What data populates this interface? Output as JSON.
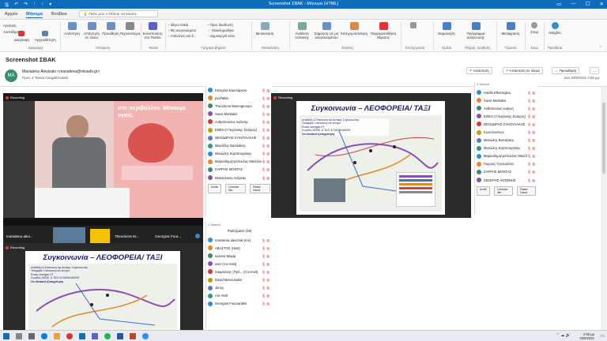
{
  "window": {
    "title": "Screenshot ΣΒΑΚ  -  Μήνυμα (HTML)"
  },
  "tabs": [
    {
      "label": "Αρχείο"
    },
    {
      "label": "Μήνυμα"
    },
    {
      "label": "Βοήθεια"
    }
  ],
  "search": {
    "placeholder": "Πείτε μου τι θέλετε να κάνετε"
  },
  "ribbon": {
    "delete": {
      "ignore": "Αγνόηση",
      "junk": "Ανεπιθύμητα",
      "delete": "Διαγραφή",
      "archive": "Αρχειοθέτηση",
      "group": "Διαγραφή"
    },
    "respond": {
      "reply": "Απάντηση",
      "reply_all": "Απάντηση σε όλους",
      "forward": "Προώθηση",
      "more": "Περισσότερα",
      "group": "Απόκριση"
    },
    "teams": {
      "share": "Κοινοποίηση στο Teams",
      "group": "Teams"
    },
    "quick_steps": {
      "items": [
        "Ιδέρα Αλικιά",
        "Μη αναγνωσμένο",
        "Απάντηση και δ...",
        "Προς διευθυντή",
        "Ολοκληρώθηκε",
        "Δημιουργία νέου"
      ],
      "group": "Γρήγορα βήματα"
    },
    "move": {
      "move": "Μετακίνηση",
      "group": "Μετακίνηση"
    },
    "tags": {
      "assign": "Ανάθεση πολιτικής",
      "mark_unread": "Σήμανση ως μη αναγνωσμένου",
      "categorize": "Κατηγοριοποίηση",
      "follow_up": "Παρακολούθηση θέματος",
      "group": "Ετικέτες"
    },
    "editing": {
      "group": "Επεξεργασία"
    },
    "speech": {
      "read": "Εκφώνηση",
      "group": "Ομιλία"
    },
    "immersive": {
      "reader": "Πρόγραμμα ανάγνωσης",
      "group": "Πλήρης προβολή"
    },
    "translate": {
      "label": "Μετάφραση",
      "group": "Γλώσσα"
    },
    "zoom": {
      "label": "Ζουμ",
      "group": "Ζουμ"
    },
    "insights": {
      "label": "Insights",
      "group": "Πρόσθετα"
    }
  },
  "message": {
    "subject": "Screenshot ΣΒΑΚ",
    "avatar_initials": "MA",
    "from": "Marialena Alevizaki <marialena@mlsadv.gr>",
    "to_label": "Προς",
    "to": "Tessa Gargathoulaki",
    "buttons": {
      "reply": "Απάντηση",
      "reply_all": "Απάντηση σε όλους",
      "forward": "Προώθηση"
    },
    "date": "Δευ 20/9/2021 2:58 μμ"
  },
  "meeting": {
    "recording_label": "Recording",
    "tiles": [
      "marialena alev...",
      "Theodoros M...",
      "Georgios Four..."
    ],
    "slide_title": "Συγκοινωνία – ΛΕΟΦΟΡΕΙΑ/ ΤΑΞΙ",
    "slide_bullets": [
      "Ανάδειξη & Επέκταση της Αστικής Συγκοινωνίας",
      "Τελεφερίκ / επέκταση στο κέντρο",
      "Ενιαίο εισιτήριο ΚΤ",
      "Λωρίδες ΛΕΩΦ. & ΤΑΞΙ & ΠΑΡΑΚΑΜΨΗ",
      "On demand εξυπηρέτηση"
    ],
    "banner_text": "στο περιβάλλον. Μένουμε υγιείς.",
    "participants_header": "Participants (28)",
    "list_a": [
      "Κατερίνα Κλεισιάρκου",
      "pvaTabla",
      "Theodoros Mavrogenopo",
      "Xanis Markakis",
      "Ανθρόπουλος Ιωάννης",
      "ΕΘΕΗ (Υπεράνκης Σταύρος)",
      "ΘΕΟΔΩΡΗΣ ΣΥΚΟΥΛΑΚΗΣ",
      "Μαυλίδης Βασιλάκης",
      "Μανώλης Καρτσουράκης",
      "Μαρκοδημητρόπουλος Μανόλιος",
      "ΣΑΡΡΗΣ ΜΟΝΤΑΣ",
      "Μαλούλιανη Ανδρέας"
    ],
    "list_b": [
      "marialena alevizaki (me)",
      "ΑΒΑΣΤΟΣ (Host)",
      "Ιωάννα Μαρία",
      "user (Co-Host)",
      "Σακμπάνης (Πρό... (Co-Host)",
      "David Manousakis",
      "Jenny",
      "Ant Hroll",
      "Georgios Fournarakis"
    ],
    "list_c": [
      "Vasilis Eftemoglou",
      "Xanis Markakis",
      "Ανθόπουλος Ιωάννη",
      "ΕΘΕΗ (Υπεράνκης Σταύρος)",
      "ΘΕΟΔΩΡΗΣ ΣΥΚΟΥΛΑΚΗΣ",
      "Κωνσταντίνος",
      "Μανώλης Βασιλάκης",
      "Μανώλης Καρτσουράκης",
      "Μαρκοδημητρόπουλος Μανόλιος",
      "Γιώργος Υγγουράτος",
      "ΣΑΡΡΗΣ ΜΟΝΤΑΣ",
      "ΣΕΚΕΡΗΣ ΑΝΤΩΝΗΣ"
    ],
    "list_buttons": [
      "Invite",
      "Unmute Me",
      "Raise Hand"
    ]
  },
  "taskbar": {
    "time": "2:59 μμ",
    "date": "20/9/2021"
  }
}
